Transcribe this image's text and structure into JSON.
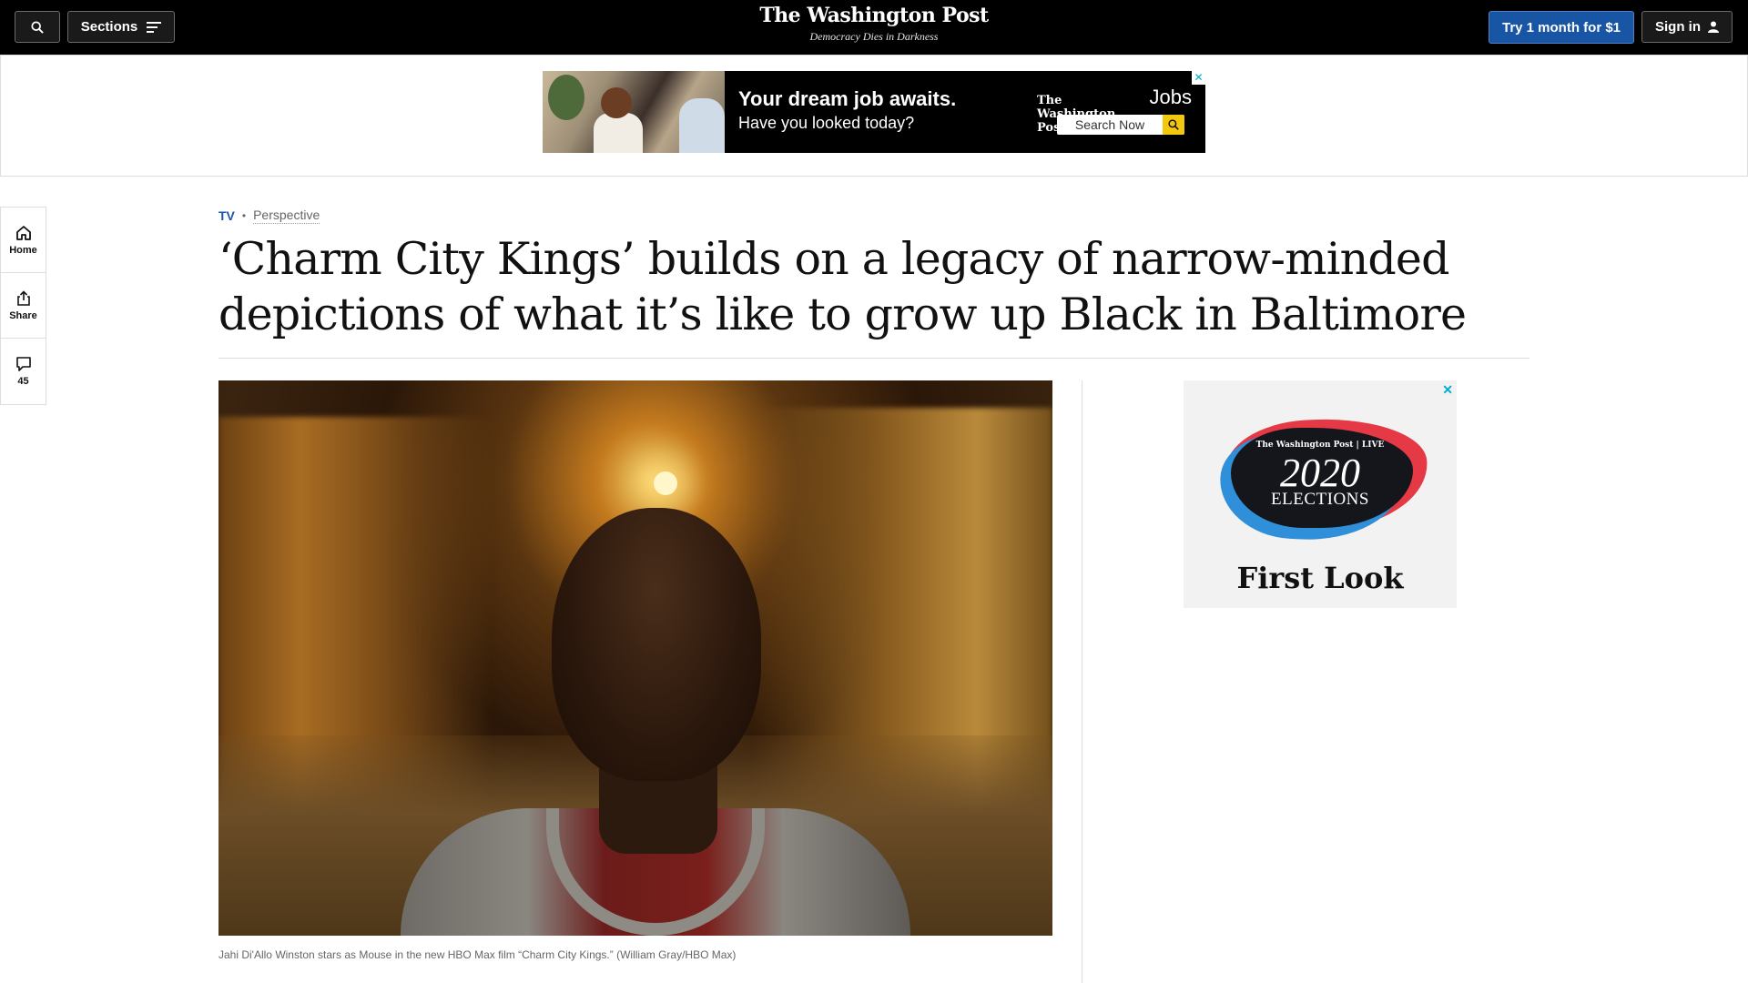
{
  "nav": {
    "sections_label": "Sections",
    "logo": "The Washington Post",
    "tagline": "Democracy Dies in Darkness",
    "subscribe_label": "Try 1 month for $1",
    "signin_label": "Sign in"
  },
  "top_ad": {
    "headline": "Your dream job awaits.",
    "subline": "Have you looked today?",
    "brand": "The Washington Post",
    "brand_suffix": "Jobs",
    "search_label": "Search Now",
    "close": "✕"
  },
  "left_rail": {
    "home": "Home",
    "share": "Share",
    "comments_count": "45"
  },
  "article": {
    "section": "TV",
    "label": "Perspective",
    "headline": "‘Charm City Kings’ builds on a legacy of narrow-minded depictions of what it’s like to grow up Black in Baltimore",
    "caption": "Jahi Di'Allo Winston stars as Mouse in the new HBO Max film “Charm City Kings.” (William Gray/HBO Max)"
  },
  "side_ad": {
    "brand": "The Washington Post | LIVE",
    "year": "2020",
    "title": "ELECTIONS",
    "subtitle": "First Look",
    "close": "✕"
  },
  "colors": {
    "accent_blue": "#1955a5",
    "nav_bg": "#000000",
    "search_yellow": "#f3c70d"
  }
}
